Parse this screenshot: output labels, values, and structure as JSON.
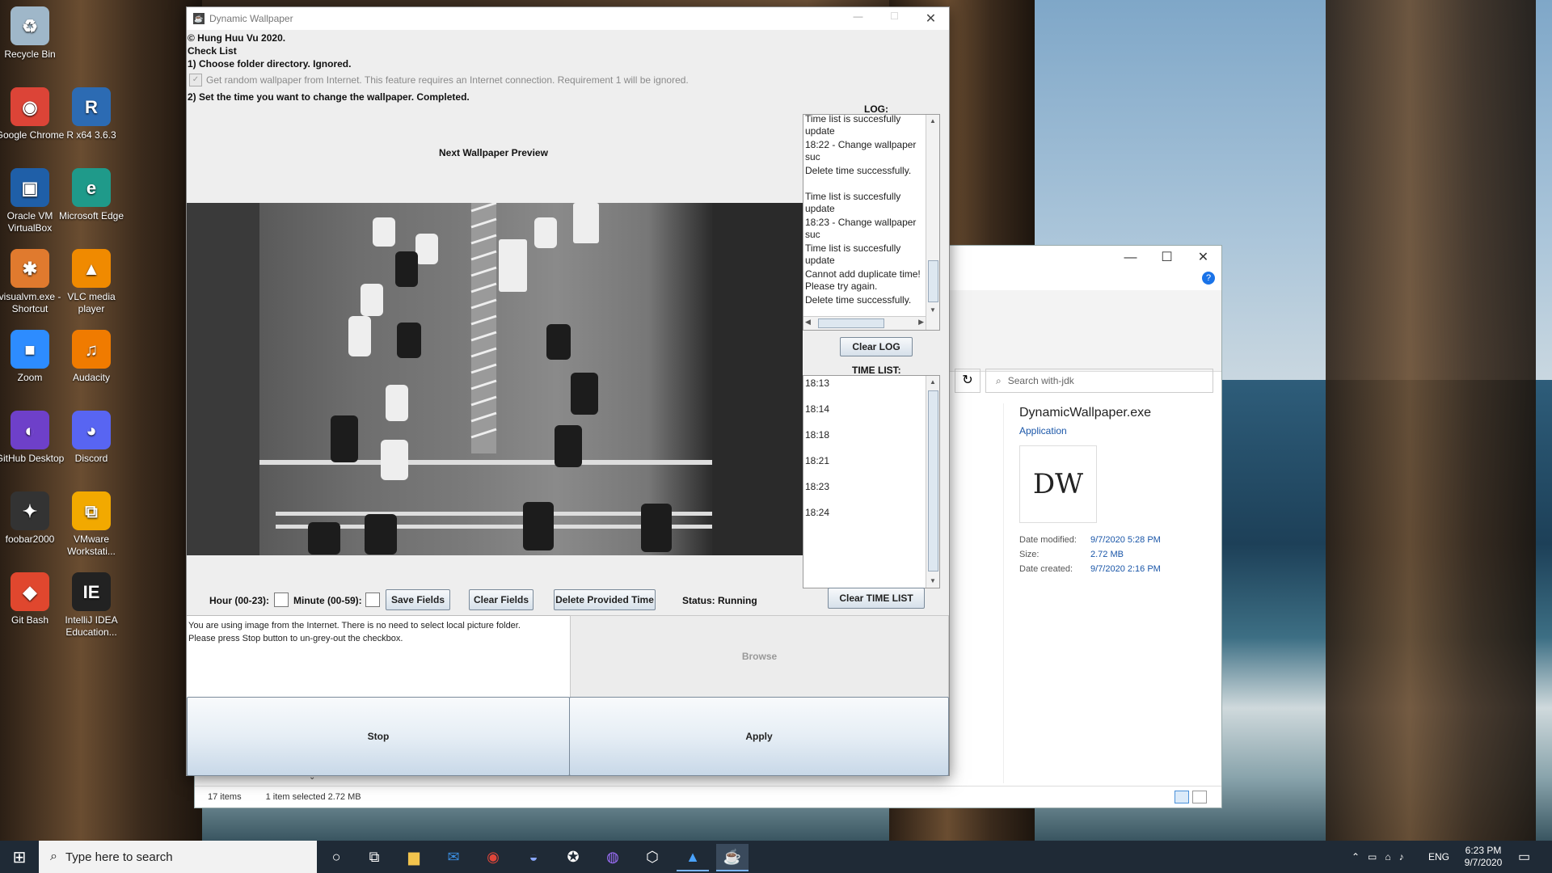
{
  "desktop": {
    "icons": [
      {
        "label": "Recycle Bin",
        "icon": "recycle-bin-icon",
        "color": "#9fb7c9",
        "glyph": "♻"
      },
      {
        "label": "Google Chrome",
        "icon": "chrome-icon",
        "color": "#dc4437",
        "glyph": "◉"
      },
      {
        "label": "R x64 3.6.3",
        "icon": "r-icon",
        "color": "#2c6bb3",
        "glyph": "R"
      },
      {
        "label": "Oracle VM VirtualBox",
        "icon": "virtualbox-icon",
        "color": "#1f5fa8",
        "glyph": "▣"
      },
      {
        "label": "Microsoft Edge",
        "icon": "edge-icon",
        "color": "#1f9a8a",
        "glyph": "e"
      },
      {
        "label": "visualvm.exe - Shortcut",
        "icon": "visualvm-icon",
        "color": "#e07a2e",
        "glyph": "✱"
      },
      {
        "label": "VLC media player",
        "icon": "vlc-icon",
        "color": "#f08a00",
        "glyph": "▲"
      },
      {
        "label": "Zoom",
        "icon": "zoom-icon",
        "color": "#2d8cff",
        "glyph": "■"
      },
      {
        "label": "Audacity",
        "icon": "audacity-icon",
        "color": "#f07b00",
        "glyph": "♫"
      },
      {
        "label": "GitHub Desktop",
        "icon": "github-desktop-icon",
        "color": "#6e40c9",
        "glyph": "◐"
      },
      {
        "label": "Discord",
        "icon": "discord-icon",
        "color": "#5865f2",
        "glyph": "◕"
      },
      {
        "label": "foobar2000",
        "icon": "foobar-icon",
        "color": "#333333",
        "glyph": "✦"
      },
      {
        "label": "VMware Workstati...",
        "icon": "vmware-icon",
        "color": "#f2a900",
        "glyph": "⧉"
      },
      {
        "label": "Git Bash",
        "icon": "git-bash-icon",
        "color": "#e0472e",
        "glyph": "◆"
      },
      {
        "label": "IntelliJ IDEA Education...",
        "icon": "intellij-icon",
        "color": "#222222",
        "glyph": "IE"
      }
    ]
  },
  "window": {
    "title": "Dynamic Wallpaper",
    "copyright": "© Hung Huu Vu 2020.",
    "checklist_title": "Check List",
    "step1": "1) Choose folder directory. Ignored.",
    "checkbox_label": "Get random wallpaper from Internet. This feature requires an Internet connection. Requirement 1 will be ignored.",
    "step2": "2) Set the time you want to change the wallpaper. Completed.",
    "preview_label": "Next Wallpaper Preview",
    "log_label": "LOG:",
    "log_entries": [
      "Time list is succesfully update",
      "18:22 - Change wallpaper suc",
      "Delete time successfully.",
      "Time list is succesfully update",
      "18:23 - Change wallpaper suc",
      "Time list is succesfully update",
      "Cannot add duplicate time! Please try again.",
      "Delete time successfully."
    ],
    "clear_log": "Clear LOG",
    "timelist_label": "TIME LIST:",
    "time_list": [
      "18:13",
      "18:14",
      "18:18",
      "18:21",
      "18:23",
      "18:24"
    ],
    "hour_label": "Hour (00-23):",
    "minute_label": "Minute (00-59):",
    "save_fields": "Save Fields",
    "clear_fields": "Clear Fields",
    "delete_time": "Delete Provided Time",
    "status": "Status: Running",
    "clear_timelist": "Clear TIME LIST",
    "info_line1": "You are using image from the Internet. There is no need to select local picture folder.",
    "info_line2": "Please press Stop button to un-grey-out the checkbox.",
    "browse": "Browse",
    "stop": "Stop",
    "apply": "Apply"
  },
  "explorer": {
    "search_placeholder": "Search with-jdk",
    "file_name": "DynamicWallpaper.exe",
    "file_type": "Application",
    "details": [
      {
        "label": "Date modified:",
        "value": "9/7/2020 5:28 PM"
      },
      {
        "label": "Size:",
        "value": "2.72 MB"
      },
      {
        "label": "Date created:",
        "value": "9/7/2020 2:16 PM"
      }
    ],
    "status_items": "17 items",
    "status_selected": "1 item selected  2.72 MB"
  },
  "taskbar": {
    "search_placeholder": "Type here to search",
    "lang": "ENG",
    "time": "6:23 PM",
    "date": "9/7/2020"
  }
}
